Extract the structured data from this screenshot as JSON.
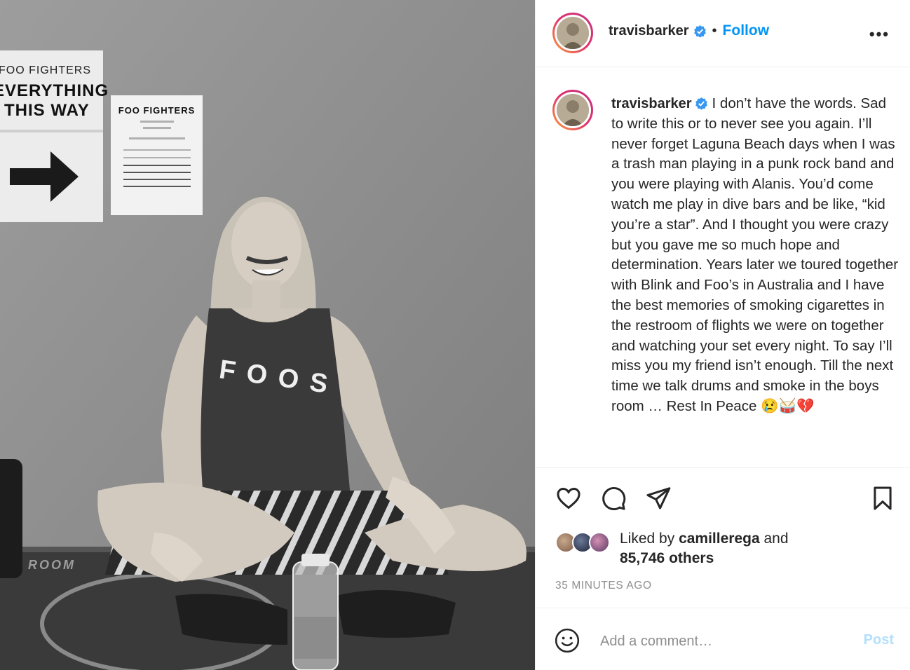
{
  "photo": {
    "sign_left_line1": "FOO FIGHTERS",
    "sign_left_line2": "EVERYTHING",
    "sign_left_line3": "THIS WAY",
    "sign_right_title": "FOO FIGHTERS",
    "shirt_text": "FOOS",
    "floor_text": "ROOM"
  },
  "header": {
    "username": "travisbarker",
    "separator": "•",
    "follow_label": "Follow",
    "more_label": "•••",
    "verified_icon": "verified-badge-icon"
  },
  "caption": {
    "username": "travisbarker",
    "text": "I don’t have the words. Sad to write this or to never see you again. I’ll never forget Laguna Beach days when I was a trash man playing in a punk rock band and you were playing with Alanis. You’d come watch me play in dive bars and be like, “kid you’re a star”. And I thought you were crazy but you gave me so much hope and determination. Years later we toured together with Blink and Foo’s in Australia and I have the best memories of smoking cigarettes in the restroom of flights we were on together and watching your set every night. To say I’ll miss you my friend isn’t enough. Till the next time we talk drums and smoke in the boys room … Rest In Peace 😢🥁💔"
  },
  "actions": {
    "like_icon": "heart-icon",
    "comment_icon": "comment-icon",
    "share_icon": "paper-plane-icon",
    "save_icon": "bookmark-icon"
  },
  "likes": {
    "prefix": "Liked by ",
    "user": "camillerega",
    "and": " and",
    "others": "85,746 others"
  },
  "timestamp": "35 MINUTES AGO",
  "comment_box": {
    "placeholder": "Add a comment…",
    "post_label": "Post"
  },
  "colors": {
    "accent": "#0095f6",
    "post_disabled": "#b2dffc",
    "text": "#262626",
    "muted": "#8e8e8e"
  }
}
